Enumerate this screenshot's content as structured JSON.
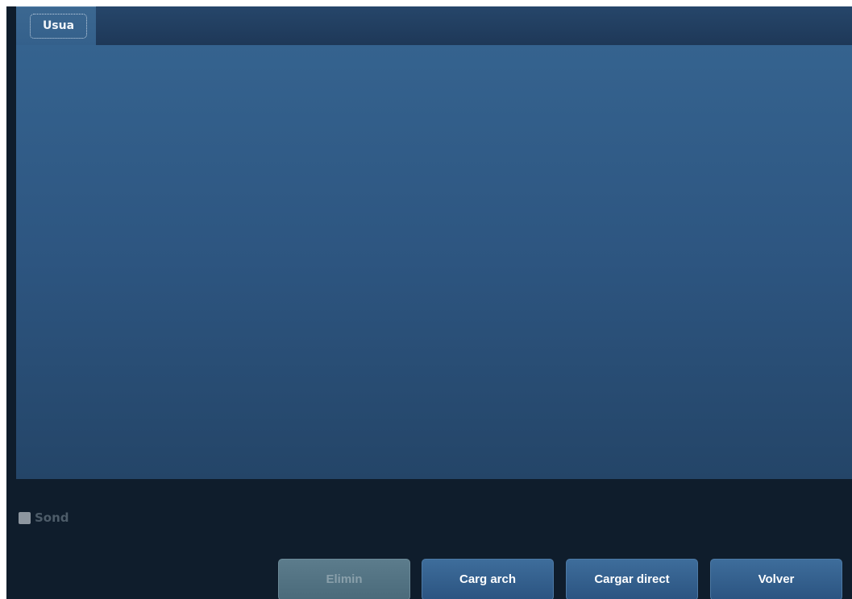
{
  "tabs": [
    {
      "label": "Usua",
      "active": true
    }
  ],
  "probe_checkbox": {
    "label": "Sond",
    "checked": false,
    "enabled": false
  },
  "buttons": {
    "delete": {
      "label": "Elimin",
      "enabled": false
    },
    "load_file": {
      "label": "Carg arch"
    },
    "load_direct": {
      "label": "Cargar direct"
    },
    "back": {
      "label": "Volver"
    }
  },
  "colors": {
    "background": "#0f1d2c",
    "panel_top": "#35638f",
    "panel_bottom": "#244568",
    "button": "#2b5481",
    "button_disabled": "#4a6a7a"
  }
}
